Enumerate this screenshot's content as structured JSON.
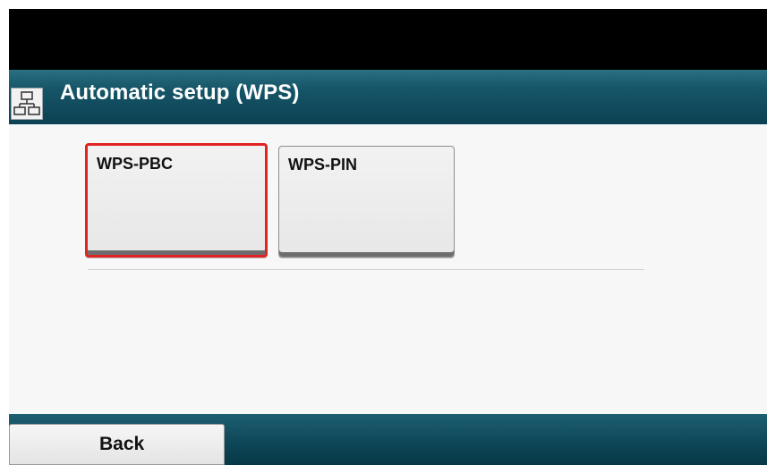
{
  "header": {
    "title": "Automatic setup (WPS)",
    "icon": "network-icon"
  },
  "options": [
    {
      "label": "WPS-PBC",
      "selected": true
    },
    {
      "label": "WPS-PIN",
      "selected": false
    }
  ],
  "footer": {
    "back_label": "Back"
  },
  "colors": {
    "title_bar": "#165568",
    "footer_bar": "#0c4656",
    "selection_outline": "#e02323",
    "content_background": "#f7f7f7"
  }
}
